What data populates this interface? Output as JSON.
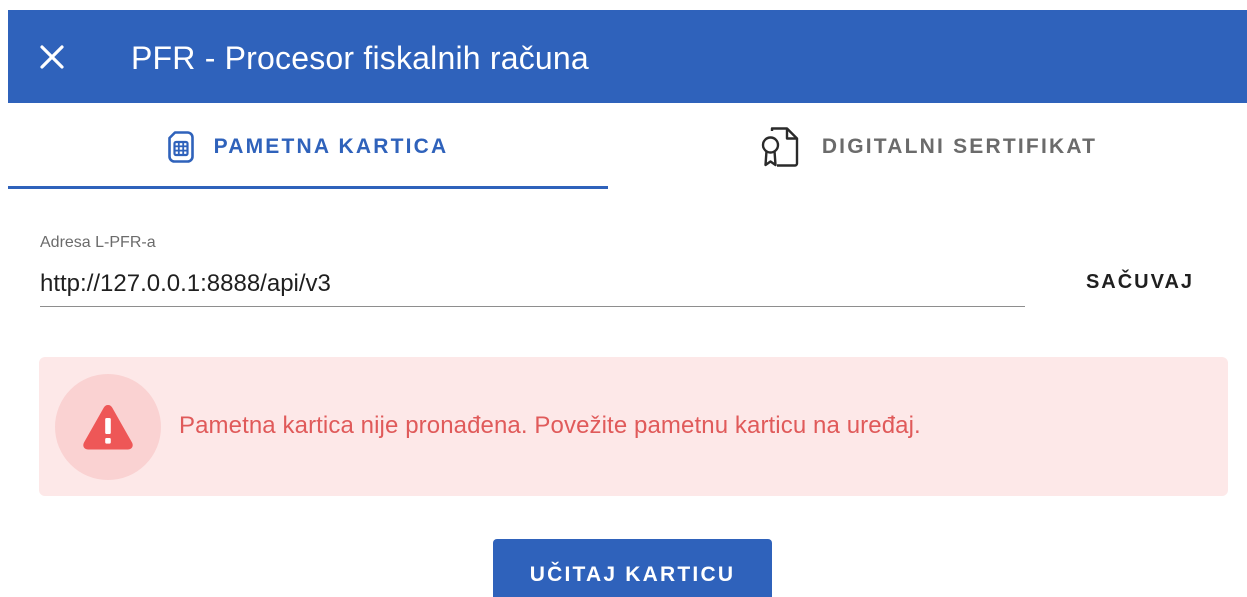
{
  "app_bar": {
    "title": "PFR - Procesor fiskalnih računa",
    "close_icon": "close-icon",
    "background_color": "#2f62bb"
  },
  "tabs": [
    {
      "label": "PAMETNA KARTICA",
      "icon": "sim-card-icon",
      "active": true
    },
    {
      "label": "DIGITALNI SERTIFIKAT",
      "icon": "certificate-document-icon",
      "active": false
    }
  ],
  "address_field": {
    "label": "Adresa L-PFR-a",
    "value": "http://127.0.0.1:8888/api/v3"
  },
  "save_button": {
    "label": "SAČUVAJ"
  },
  "alert": {
    "icon": "warning-icon",
    "message": "Pametna kartica nije pronađena. Povežite pametnu karticu na uređaj.",
    "text_color": "#e05a5a",
    "background_color": "#fde8e8"
  },
  "load_button": {
    "label": "UČITAJ KARTICU"
  },
  "colors": {
    "accent": "#2f62bb",
    "error": "#e05a5a"
  }
}
